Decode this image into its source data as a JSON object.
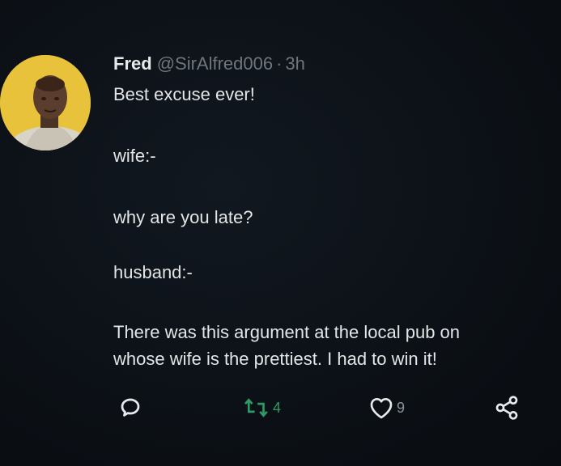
{
  "tweet": {
    "author_name": "Fred",
    "author_handle": "@SirAlfred006",
    "separator": "·",
    "time": "3h",
    "lines": [
      "Best excuse ever!",
      "wife:-",
      "why are you late?",
      "husband:-",
      "There was this argument at the local pub on",
      "whose wife is the prettiest. I had to win it!"
    ]
  },
  "actions": {
    "reply_icon": "reply-icon",
    "retweet_icon": "retweet-icon",
    "retweet_count": "4",
    "like_icon": "heart-icon",
    "like_count": "9",
    "share_icon": "share-icon"
  },
  "colors": {
    "background": "#0b0f14",
    "text": "#e7e9ea",
    "muted": "#6e767d",
    "retweet_active": "#2e9a66",
    "avatar_bg": "#e8c23a"
  }
}
